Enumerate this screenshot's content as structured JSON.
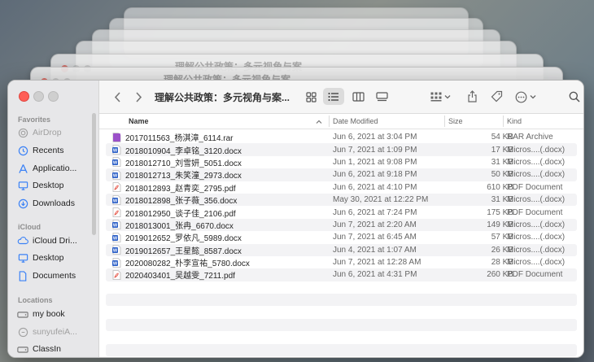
{
  "window": {
    "title": "理解公共政策：多元视角与案..."
  },
  "ghost_titles": [
    "理解公共政策：多元视角与案",
    "理解公共政策：多元视角与案"
  ],
  "sidebar": {
    "sections": [
      {
        "label": "Favorites"
      },
      {
        "label": "iCloud"
      },
      {
        "label": "Locations"
      }
    ],
    "favorites": [
      {
        "label": "AirDrop",
        "icon": "airdrop-icon",
        "dim": true
      },
      {
        "label": "Recents",
        "icon": "clock-icon"
      },
      {
        "label": "Applicatio...",
        "icon": "applications-icon"
      },
      {
        "label": "Desktop",
        "icon": "desktop-icon"
      },
      {
        "label": "Downloads",
        "icon": "download-icon"
      }
    ],
    "icloud": [
      {
        "label": "iCloud Dri...",
        "icon": "cloud-icon"
      },
      {
        "label": "Desktop",
        "icon": "desktop-icon"
      },
      {
        "label": "Documents",
        "icon": "document-icon"
      }
    ],
    "locations": [
      {
        "label": "my book",
        "icon": "drive-icon"
      },
      {
        "label": "sunyufeiA...",
        "icon": "network-icon",
        "dim": true
      },
      {
        "label": "ClassIn",
        "icon": "drive-icon"
      }
    ]
  },
  "columns": {
    "name": "Name",
    "date": "Date Modified",
    "size": "Size",
    "kind": "Kind"
  },
  "colors": {
    "pdf": "#e34a3b",
    "docx": "#2b5fc7",
    "rar": "#9b51c9",
    "close": "#ff5f57"
  },
  "files": [
    {
      "name": "2017011563_杨淇漳_6114.rar",
      "date": "Jun 6, 2021 at 3:04 PM",
      "size": "54 KB",
      "kind": "RAR Archive",
      "type": "rar"
    },
    {
      "name": "2018010904_李卓铭_3120.docx",
      "date": "Jun 7, 2021 at 1:09 PM",
      "size": "17 KB",
      "kind": "Micros....(.docx)",
      "type": "docx"
    },
    {
      "name": "2018012710_刘雪妍_5051.docx",
      "date": "Jun 1, 2021 at 9:08 PM",
      "size": "31 KB",
      "kind": "Micros....(.docx)",
      "type": "docx"
    },
    {
      "name": "2018012713_朱笑潼_2973.docx",
      "date": "Jun 6, 2021 at 9:18 PM",
      "size": "50 KB",
      "kind": "Micros....(.docx)",
      "type": "docx"
    },
    {
      "name": "2018012893_赵青奕_2795.pdf",
      "date": "Jun 6, 2021 at 4:10 PM",
      "size": "610 KB",
      "kind": "PDF Document",
      "type": "pdf"
    },
    {
      "name": "2018012898_张子薇_356.docx",
      "date": "May 30, 2021 at 12:22 PM",
      "size": "31 KB",
      "kind": "Micros....(.docx)",
      "type": "docx"
    },
    {
      "name": "2018012950_谈子佳_2106.pdf",
      "date": "Jun 6, 2021 at 7:24 PM",
      "size": "175 KB",
      "kind": "PDF Document",
      "type": "pdf"
    },
    {
      "name": "2018013001_张冉_6670.docx",
      "date": "Jun 7, 2021 at 2:20 AM",
      "size": "149 KB",
      "kind": "Micros....(.docx)",
      "type": "docx"
    },
    {
      "name": "2019012652_罗依凡_5989.docx",
      "date": "Jun 7, 2021 at 6:45 AM",
      "size": "57 KB",
      "kind": "Micros....(.docx)",
      "type": "docx"
    },
    {
      "name": "2019012657_王星懿_8587.docx",
      "date": "Jun 4, 2021 at 1:07 AM",
      "size": "26 KB",
      "kind": "Micros....(.docx)",
      "type": "docx"
    },
    {
      "name": "2020080282_朴李宣祐_5780.docx",
      "date": "Jun 7, 2021 at 12:28 AM",
      "size": "28 KB",
      "kind": "Micros....(.docx)",
      "type": "docx"
    },
    {
      "name": "2020403401_吴越雯_7211.pdf",
      "date": "Jun 6, 2021 at 4:31 PM",
      "size": "260 KB",
      "kind": "PDF Document",
      "type": "pdf"
    }
  ]
}
